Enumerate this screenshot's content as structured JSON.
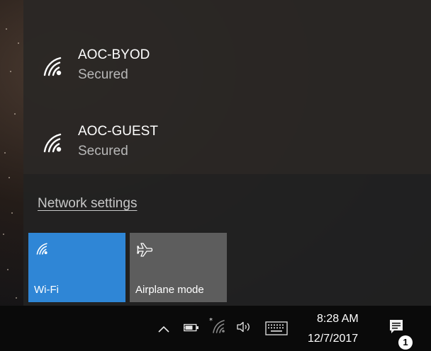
{
  "networks": [
    {
      "name": "AOC-BYOD",
      "status": "Secured",
      "icon": "wifi-signal-icon"
    },
    {
      "name": "AOC-GUEST",
      "status": "Secured",
      "icon": "wifi-signal-icon"
    }
  ],
  "network_settings_link": "Network settings",
  "quick_actions": {
    "wifi": {
      "label": "Wi-Fi",
      "icon": "wifi-icon",
      "active": true,
      "color": "#2f86d6"
    },
    "airplane": {
      "label": "Airplane mode",
      "icon": "airplane-icon",
      "active": false,
      "color": "#5d5d5d"
    }
  },
  "taskbar": {
    "time": "8:28 AM",
    "date": "12/7/2017",
    "notification_count": "1",
    "icons": [
      "chevron-up-icon",
      "battery-icon",
      "wifi-tray-icon",
      "volume-icon",
      "keyboard-icon",
      "action-center-icon"
    ]
  }
}
